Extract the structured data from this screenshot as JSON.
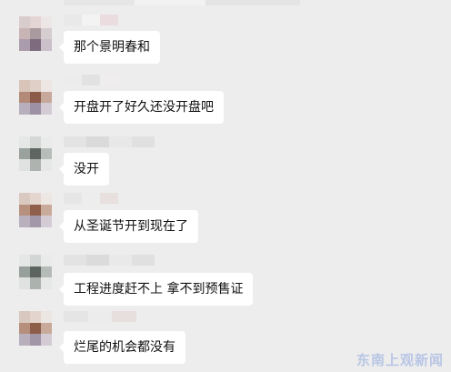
{
  "messages": [
    {
      "text": "那个景明春和",
      "avatar": "blurred-avatar-1"
    },
    {
      "text": "开盘开了好久还没开盘吧",
      "avatar": "blurred-avatar-1"
    },
    {
      "text": "没开",
      "avatar": "blurred-avatar-2"
    },
    {
      "text": "从圣诞节开到现在了",
      "avatar": "blurred-avatar-1"
    },
    {
      "text": "工程进度赶不上  拿不到预售证",
      "avatar": "blurred-avatar-2"
    },
    {
      "text": "烂尾的机会都没有",
      "avatar": "blurred-avatar-1"
    }
  ],
  "watermark": "东南上观新闻",
  "colors": {
    "background": "#ededed",
    "bubble": "#ffffff",
    "text": "#111111"
  }
}
